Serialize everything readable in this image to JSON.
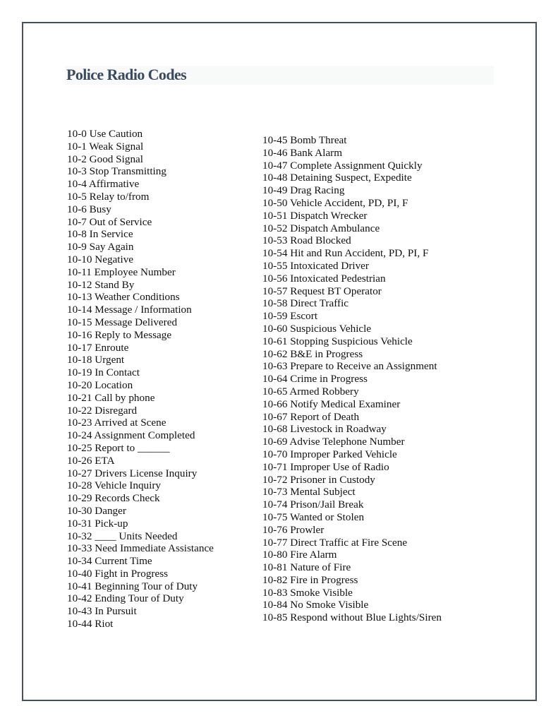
{
  "document": {
    "title": "Police Radio Codes",
    "colors": {
      "title": "#3c4a5e",
      "border": "#48505c",
      "text": "#111111"
    }
  },
  "codes_left": [
    {
      "code": "10-0",
      "meaning": "Use Caution"
    },
    {
      "code": "10-1",
      "meaning": "Weak Signal"
    },
    {
      "code": "10-2",
      "meaning": "Good Signal"
    },
    {
      "code": "10-3",
      "meaning": "Stop Transmitting"
    },
    {
      "code": "10-4",
      "meaning": "Affirmative"
    },
    {
      "code": "10-5",
      "meaning": "Relay to/from"
    },
    {
      "code": "10-6",
      "meaning": "Busy"
    },
    {
      "code": "10-7",
      "meaning": "Out of Service"
    },
    {
      "code": "10-8",
      "meaning": "In Service"
    },
    {
      "code": "10-9",
      "meaning": "Say Again"
    },
    {
      "code": "10-10",
      "meaning": "Negative"
    },
    {
      "code": "10-11",
      "meaning": "Employee Number"
    },
    {
      "code": "10-12",
      "meaning": "Stand By"
    },
    {
      "code": "10-13",
      "meaning": "Weather Conditions"
    },
    {
      "code": "10-14",
      "meaning": "Message / Information"
    },
    {
      "code": "10-15",
      "meaning": "Message Delivered"
    },
    {
      "code": "10-16",
      "meaning": "Reply to Message"
    },
    {
      "code": "10-17",
      "meaning": "Enroute"
    },
    {
      "code": "10-18",
      "meaning": "Urgent"
    },
    {
      "code": "10-19",
      "meaning": "In Contact"
    },
    {
      "code": "10-20",
      "meaning": "Location"
    },
    {
      "code": "10-21",
      "meaning": "Call by phone"
    },
    {
      "code": "10-22",
      "meaning": "Disregard"
    },
    {
      "code": "10-23",
      "meaning": "Arrived at Scene"
    },
    {
      "code": "10-24",
      "meaning": "Assignment Completed"
    },
    {
      "code": "10-25",
      "meaning": "Report to ______"
    },
    {
      "code": "10-26",
      "meaning": "ETA"
    },
    {
      "code": "10-27",
      "meaning": "Drivers License Inquiry"
    },
    {
      "code": "10-28",
      "meaning": "Vehicle Inquiry"
    },
    {
      "code": "10-29",
      "meaning": "Records Check"
    },
    {
      "code": "10-30",
      "meaning": "Danger"
    },
    {
      "code": "10-31",
      "meaning": "Pick-up"
    },
    {
      "code": "10-32",
      "meaning": "____ Units Needed"
    },
    {
      "code": "10-33",
      "meaning": "Need Immediate Assistance"
    },
    {
      "code": "10-34",
      "meaning": "Current Time"
    },
    {
      "code": "10-40",
      "meaning": "Fight in Progress"
    },
    {
      "code": "10-41",
      "meaning": "Beginning Tour of Duty"
    },
    {
      "code": "10-42",
      "meaning": "Ending Tour of Duty"
    },
    {
      "code": "10-43",
      "meaning": "In Pursuit"
    },
    {
      "code": "10-44",
      "meaning": "Riot"
    }
  ],
  "codes_right": [
    {
      "code": "10-45",
      "meaning": "Bomb Threat"
    },
    {
      "code": "10-46",
      "meaning": "Bank Alarm"
    },
    {
      "code": "10-47",
      "meaning": "Complete Assignment Quickly"
    },
    {
      "code": "10-48",
      "meaning": "Detaining Suspect, Expedite"
    },
    {
      "code": "10-49",
      "meaning": "Drag Racing"
    },
    {
      "code": "10-50",
      "meaning": "Vehicle Accident, PD, PI, F"
    },
    {
      "code": "10-51",
      "meaning": "Dispatch Wrecker"
    },
    {
      "code": "10-52",
      "meaning": "Dispatch Ambulance"
    },
    {
      "code": "10-53",
      "meaning": "Road Blocked"
    },
    {
      "code": "10-54",
      "meaning": "Hit and Run Accident, PD, PI, F"
    },
    {
      "code": "10-55",
      "meaning": "Intoxicated Driver"
    },
    {
      "code": "10-56",
      "meaning": "Intoxicated Pedestrian"
    },
    {
      "code": "10-57",
      "meaning": "Request BT Operator"
    },
    {
      "code": "10-58",
      "meaning": "Direct Traffic"
    },
    {
      "code": "10-59",
      "meaning": "Escort"
    },
    {
      "code": "10-60",
      "meaning": "Suspicious Vehicle"
    },
    {
      "code": "10-61",
      "meaning": "Stopping Suspicious Vehicle"
    },
    {
      "code": "10-62",
      "meaning": "B&E in Progress"
    },
    {
      "code": "10-63",
      "meaning": "Prepare to Receive an Assignment"
    },
    {
      "code": "10-64",
      "meaning": "Crime in Progress"
    },
    {
      "code": "10-65",
      "meaning": "Armed Robbery"
    },
    {
      "code": "10-66",
      "meaning": "Notify Medical Examiner"
    },
    {
      "code": "10-67",
      "meaning": "Report of Death"
    },
    {
      "code": "10-68",
      "meaning": "Livestock in Roadway"
    },
    {
      "code": "10-69",
      "meaning": "Advise Telephone Number"
    },
    {
      "code": "10-70",
      "meaning": "Improper Parked Vehicle"
    },
    {
      "code": "10-71",
      "meaning": "Improper Use of Radio"
    },
    {
      "code": "10-72",
      "meaning": "Prisoner in Custody"
    },
    {
      "code": "10-73",
      "meaning": "Mental Subject"
    },
    {
      "code": "10-74",
      "meaning": "Prison/Jail Break"
    },
    {
      "code": "10-75",
      "meaning": "Wanted or Stolen"
    },
    {
      "code": "10-76",
      "meaning": "Prowler"
    },
    {
      "code": "10-77",
      "meaning": "Direct Traffic at Fire Scene"
    },
    {
      "code": "10-80",
      "meaning": "Fire Alarm"
    },
    {
      "code": "10-81",
      "meaning": "Nature of Fire"
    },
    {
      "code": "10-82",
      "meaning": "Fire in Progress"
    },
    {
      "code": "10-83",
      "meaning": "Smoke Visible"
    },
    {
      "code": "10-84",
      "meaning": "No Smoke Visible"
    },
    {
      "code": "10-85",
      "meaning": "Respond without Blue Lights/Siren"
    }
  ]
}
